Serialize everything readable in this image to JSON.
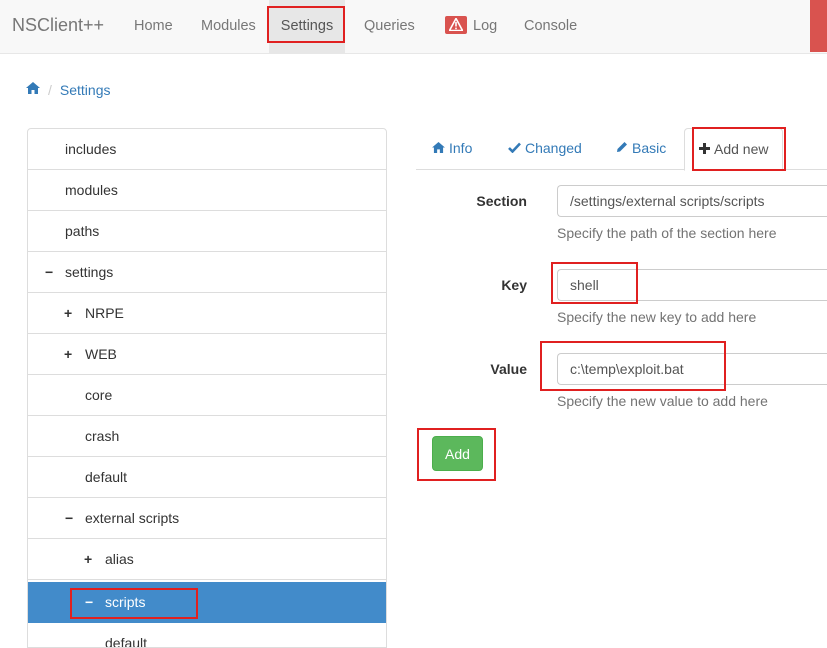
{
  "navbar": {
    "brand": "NSClient++",
    "items": [
      {
        "label": "Home"
      },
      {
        "label": "Modules"
      },
      {
        "label": "Settings"
      },
      {
        "label": "Queries"
      },
      {
        "label": "Log"
      },
      {
        "label": "Console"
      }
    ],
    "active": "Settings"
  },
  "breadcrumb": {
    "current": "Settings",
    "separator": "/"
  },
  "tree": {
    "items": [
      {
        "label": "includes",
        "toggle": ""
      },
      {
        "label": "modules",
        "toggle": ""
      },
      {
        "label": "paths",
        "toggle": ""
      },
      {
        "label": "settings",
        "toggle": "−"
      },
      {
        "label": "NRPE",
        "toggle": "+"
      },
      {
        "label": "WEB",
        "toggle": "+"
      },
      {
        "label": "core",
        "toggle": ""
      },
      {
        "label": "crash",
        "toggle": ""
      },
      {
        "label": "default",
        "toggle": ""
      },
      {
        "label": "external scripts",
        "toggle": "−"
      },
      {
        "label": "alias",
        "toggle": "+"
      },
      {
        "label": "scripts",
        "toggle": "−"
      },
      {
        "label": "default",
        "toggle": ""
      }
    ],
    "selected": "scripts"
  },
  "tabs": [
    {
      "label": "Info",
      "icon": "home-icon"
    },
    {
      "label": "Changed",
      "icon": "check-icon"
    },
    {
      "label": "Basic",
      "icon": "pencil-icon"
    },
    {
      "label": "Add new",
      "icon": "plus-icon"
    }
  ],
  "active_tab": "Add new",
  "form": {
    "section": {
      "label": "Section",
      "value": "/settings/external scripts/scripts",
      "help": "Specify the path of the section here"
    },
    "key": {
      "label": "Key",
      "value": "shell",
      "help": "Specify the new key to add here"
    },
    "value": {
      "label": "Value",
      "value": "c:\\temp\\exploit.bat",
      "help": "Specify the new value to add here"
    },
    "submit_label": "Add"
  },
  "colors": {
    "primary": "#337ab7",
    "selected": "#428bca",
    "success": "#5cb85c",
    "danger": "#d9534f",
    "annotation": "#e02020"
  }
}
